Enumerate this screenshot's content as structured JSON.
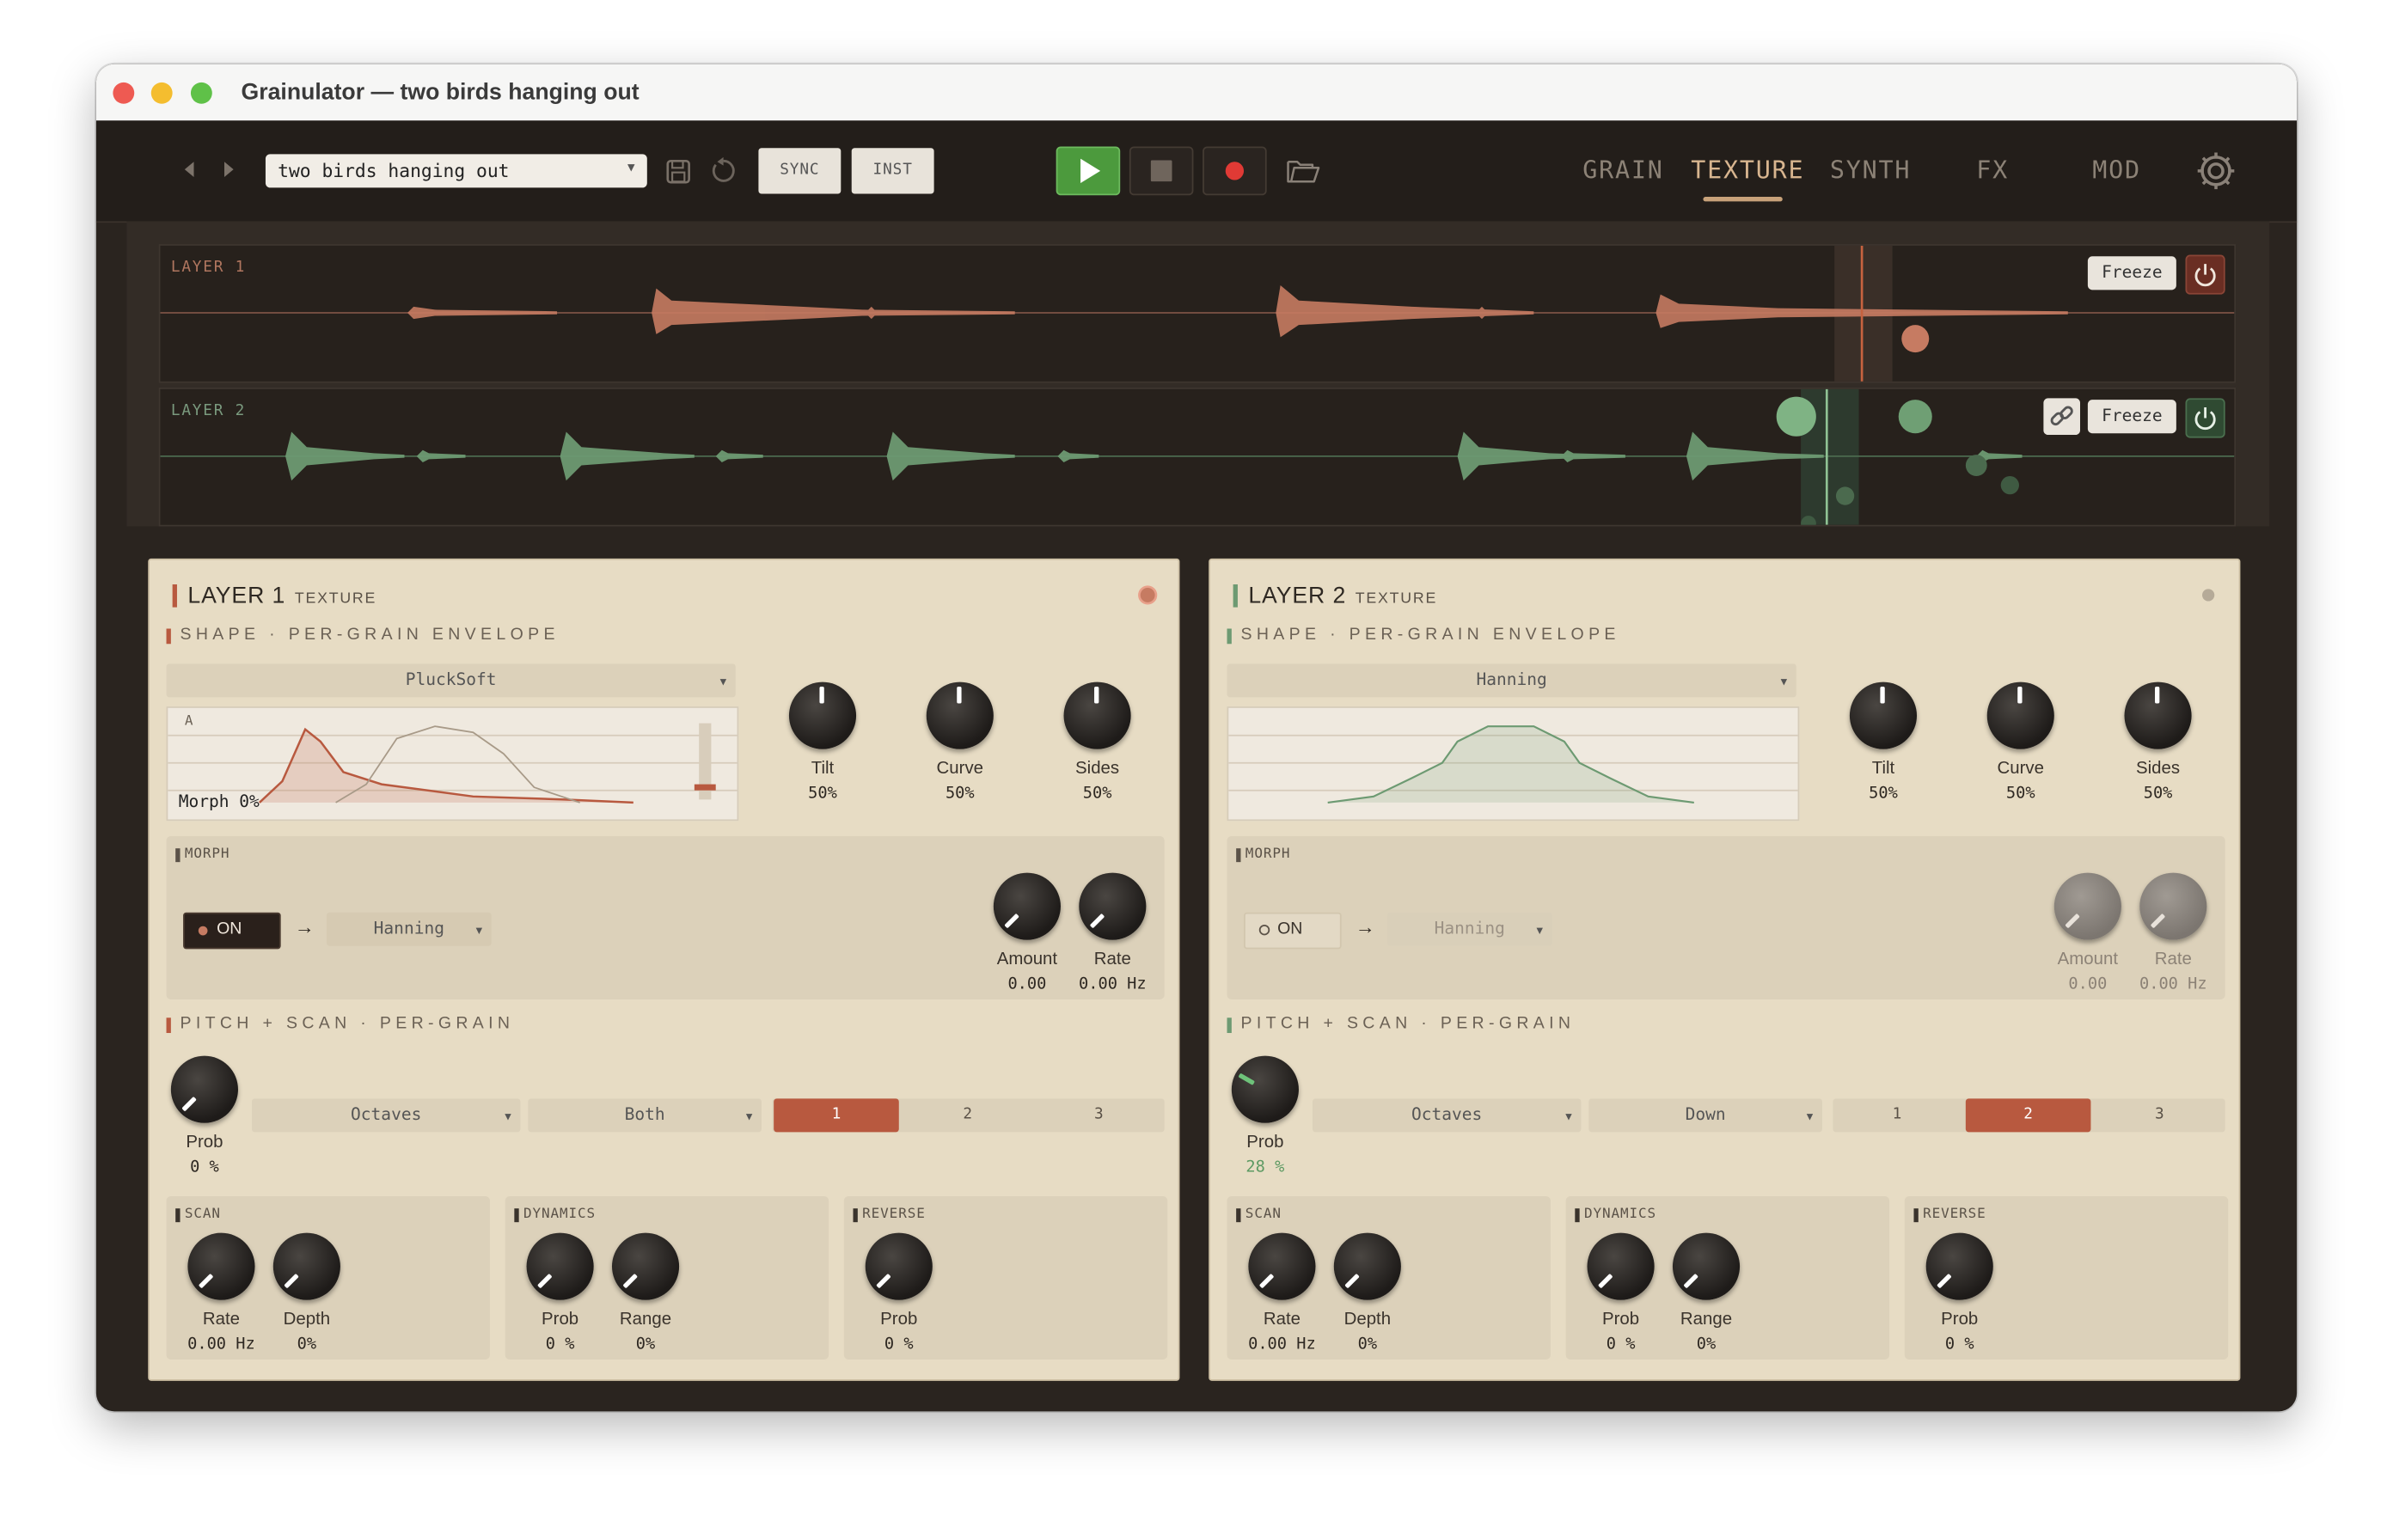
{
  "window": {
    "title": "Grainulator — two birds hanging out"
  },
  "toolbar": {
    "preset": "two birds hanging out",
    "sync_label": "SYNC",
    "inst_label": "INST",
    "tabs": [
      "GRAIN",
      "TEXTURE",
      "SYNTH",
      "FX",
      "MOD"
    ],
    "active_tab": "TEXTURE"
  },
  "lanes": [
    {
      "label": "LAYER 1",
      "freeze": "Freeze",
      "color": "#c67b62"
    },
    {
      "label": "LAYER 2",
      "freeze": "Freeze",
      "color": "#6d9a72"
    }
  ],
  "layers": [
    {
      "title": "LAYER 1",
      "tag": "TEXTURE",
      "accent": "#b8593f",
      "shape": {
        "header": "SHAPE · PER-GRAIN ENVELOPE",
        "envelope": "PluckSoft",
        "env_letter": "A",
        "morph_readout": "Morph 0%",
        "knobs": [
          {
            "label": "Tilt",
            "value": "50%"
          },
          {
            "label": "Curve",
            "value": "50%"
          },
          {
            "label": "Sides",
            "value": "50%"
          }
        ]
      },
      "morph": {
        "title": "MORPH",
        "on_label": "ON",
        "arrow": "→",
        "target": "Hanning",
        "knobs": [
          {
            "label": "Amount",
            "value": "0.00"
          },
          {
            "label": "Rate",
            "value": "0.00 Hz"
          }
        ]
      },
      "pitch": {
        "header": "PITCH + SCAN · PER-GRAIN",
        "prob": {
          "label": "Prob",
          "value": "0 %"
        },
        "mode": "Octaves",
        "direction": "Both",
        "segments": [
          "1",
          "2",
          "3"
        ],
        "selected_segment": "1"
      },
      "scan": {
        "title": "SCAN",
        "knobs": [
          {
            "label": "Rate",
            "value": "0.00 Hz"
          },
          {
            "label": "Depth",
            "value": "0%"
          }
        ]
      },
      "dynamics": {
        "title": "DYNAMICS",
        "knobs": [
          {
            "label": "Prob",
            "value": "0 %"
          },
          {
            "label": "Range",
            "value": "0%"
          }
        ]
      },
      "reverse": {
        "title": "REVERSE",
        "knobs": [
          {
            "label": "Prob",
            "value": "0 %"
          }
        ]
      }
    },
    {
      "title": "LAYER 2",
      "tag": "TEXTURE",
      "accent": "#6d9a72",
      "shape": {
        "header": "SHAPE · PER-GRAIN ENVELOPE",
        "envelope": "Hanning",
        "knobs": [
          {
            "label": "Tilt",
            "value": "50%"
          },
          {
            "label": "Curve",
            "value": "50%"
          },
          {
            "label": "Sides",
            "value": "50%"
          }
        ]
      },
      "morph": {
        "title": "MORPH",
        "on_label": "ON",
        "arrow": "→",
        "target": "Hanning",
        "knobs": [
          {
            "label": "Amount",
            "value": "0.00"
          },
          {
            "label": "Rate",
            "value": "0.00 Hz"
          }
        ]
      },
      "pitch": {
        "header": "PITCH + SCAN · PER-GRAIN",
        "prob": {
          "label": "Prob",
          "value": "28 %"
        },
        "mode": "Octaves",
        "direction": "Down",
        "segments": [
          "1",
          "2",
          "3"
        ],
        "selected_segment": "2"
      },
      "scan": {
        "title": "SCAN",
        "knobs": [
          {
            "label": "Rate",
            "value": "0.00 Hz"
          },
          {
            "label": "Depth",
            "value": "0%"
          }
        ]
      },
      "dynamics": {
        "title": "DYNAMICS",
        "knobs": [
          {
            "label": "Prob",
            "value": "0 %"
          },
          {
            "label": "Range",
            "value": "0%"
          }
        ]
      },
      "reverse": {
        "title": "REVERSE",
        "knobs": [
          {
            "label": "Prob",
            "value": "0 %"
          }
        ]
      }
    }
  ],
  "icons": [
    "chevron-left-icon",
    "chevron-right-icon",
    "save-icon",
    "undo-icon",
    "play-icon",
    "stop-icon",
    "record-icon",
    "folder-icon",
    "gear-icon",
    "power-icon",
    "link-icon"
  ]
}
